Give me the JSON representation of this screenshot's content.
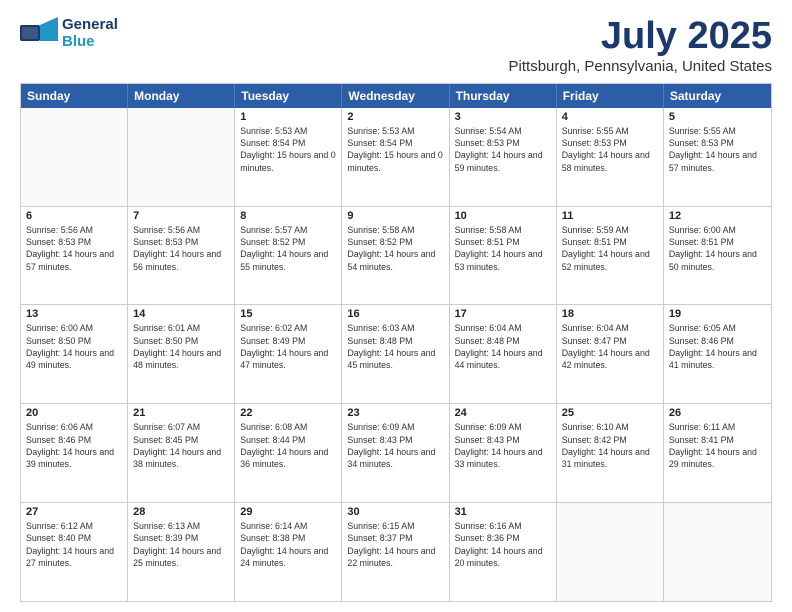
{
  "header": {
    "logo_general": "General",
    "logo_blue": "Blue",
    "main_title": "July 2025",
    "subtitle": "Pittsburgh, Pennsylvania, United States"
  },
  "calendar": {
    "days": [
      "Sunday",
      "Monday",
      "Tuesday",
      "Wednesday",
      "Thursday",
      "Friday",
      "Saturday"
    ],
    "rows": [
      [
        {
          "day": "",
          "empty": true
        },
        {
          "day": "",
          "empty": true
        },
        {
          "day": "1",
          "sunrise": "Sunrise: 5:53 AM",
          "sunset": "Sunset: 8:54 PM",
          "daylight": "Daylight: 15 hours and 0 minutes."
        },
        {
          "day": "2",
          "sunrise": "Sunrise: 5:53 AM",
          "sunset": "Sunset: 8:54 PM",
          "daylight": "Daylight: 15 hours and 0 minutes."
        },
        {
          "day": "3",
          "sunrise": "Sunrise: 5:54 AM",
          "sunset": "Sunset: 8:53 PM",
          "daylight": "Daylight: 14 hours and 59 minutes."
        },
        {
          "day": "4",
          "sunrise": "Sunrise: 5:55 AM",
          "sunset": "Sunset: 8:53 PM",
          "daylight": "Daylight: 14 hours and 58 minutes."
        },
        {
          "day": "5",
          "sunrise": "Sunrise: 5:55 AM",
          "sunset": "Sunset: 8:53 PM",
          "daylight": "Daylight: 14 hours and 57 minutes."
        }
      ],
      [
        {
          "day": "6",
          "sunrise": "Sunrise: 5:56 AM",
          "sunset": "Sunset: 8:53 PM",
          "daylight": "Daylight: 14 hours and 57 minutes."
        },
        {
          "day": "7",
          "sunrise": "Sunrise: 5:56 AM",
          "sunset": "Sunset: 8:53 PM",
          "daylight": "Daylight: 14 hours and 56 minutes."
        },
        {
          "day": "8",
          "sunrise": "Sunrise: 5:57 AM",
          "sunset": "Sunset: 8:52 PM",
          "daylight": "Daylight: 14 hours and 55 minutes."
        },
        {
          "day": "9",
          "sunrise": "Sunrise: 5:58 AM",
          "sunset": "Sunset: 8:52 PM",
          "daylight": "Daylight: 14 hours and 54 minutes."
        },
        {
          "day": "10",
          "sunrise": "Sunrise: 5:58 AM",
          "sunset": "Sunset: 8:51 PM",
          "daylight": "Daylight: 14 hours and 53 minutes."
        },
        {
          "day": "11",
          "sunrise": "Sunrise: 5:59 AM",
          "sunset": "Sunset: 8:51 PM",
          "daylight": "Daylight: 14 hours and 52 minutes."
        },
        {
          "day": "12",
          "sunrise": "Sunrise: 6:00 AM",
          "sunset": "Sunset: 8:51 PM",
          "daylight": "Daylight: 14 hours and 50 minutes."
        }
      ],
      [
        {
          "day": "13",
          "sunrise": "Sunrise: 6:00 AM",
          "sunset": "Sunset: 8:50 PM",
          "daylight": "Daylight: 14 hours and 49 minutes."
        },
        {
          "day": "14",
          "sunrise": "Sunrise: 6:01 AM",
          "sunset": "Sunset: 8:50 PM",
          "daylight": "Daylight: 14 hours and 48 minutes."
        },
        {
          "day": "15",
          "sunrise": "Sunrise: 6:02 AM",
          "sunset": "Sunset: 8:49 PM",
          "daylight": "Daylight: 14 hours and 47 minutes."
        },
        {
          "day": "16",
          "sunrise": "Sunrise: 6:03 AM",
          "sunset": "Sunset: 8:48 PM",
          "daylight": "Daylight: 14 hours and 45 minutes."
        },
        {
          "day": "17",
          "sunrise": "Sunrise: 6:04 AM",
          "sunset": "Sunset: 8:48 PM",
          "daylight": "Daylight: 14 hours and 44 minutes."
        },
        {
          "day": "18",
          "sunrise": "Sunrise: 6:04 AM",
          "sunset": "Sunset: 8:47 PM",
          "daylight": "Daylight: 14 hours and 42 minutes."
        },
        {
          "day": "19",
          "sunrise": "Sunrise: 6:05 AM",
          "sunset": "Sunset: 8:46 PM",
          "daylight": "Daylight: 14 hours and 41 minutes."
        }
      ],
      [
        {
          "day": "20",
          "sunrise": "Sunrise: 6:06 AM",
          "sunset": "Sunset: 8:46 PM",
          "daylight": "Daylight: 14 hours and 39 minutes."
        },
        {
          "day": "21",
          "sunrise": "Sunrise: 6:07 AM",
          "sunset": "Sunset: 8:45 PM",
          "daylight": "Daylight: 14 hours and 38 minutes."
        },
        {
          "day": "22",
          "sunrise": "Sunrise: 6:08 AM",
          "sunset": "Sunset: 8:44 PM",
          "daylight": "Daylight: 14 hours and 36 minutes."
        },
        {
          "day": "23",
          "sunrise": "Sunrise: 6:09 AM",
          "sunset": "Sunset: 8:43 PM",
          "daylight": "Daylight: 14 hours and 34 minutes."
        },
        {
          "day": "24",
          "sunrise": "Sunrise: 6:09 AM",
          "sunset": "Sunset: 8:43 PM",
          "daylight": "Daylight: 14 hours and 33 minutes."
        },
        {
          "day": "25",
          "sunrise": "Sunrise: 6:10 AM",
          "sunset": "Sunset: 8:42 PM",
          "daylight": "Daylight: 14 hours and 31 minutes."
        },
        {
          "day": "26",
          "sunrise": "Sunrise: 6:11 AM",
          "sunset": "Sunset: 8:41 PM",
          "daylight": "Daylight: 14 hours and 29 minutes."
        }
      ],
      [
        {
          "day": "27",
          "sunrise": "Sunrise: 6:12 AM",
          "sunset": "Sunset: 8:40 PM",
          "daylight": "Daylight: 14 hours and 27 minutes."
        },
        {
          "day": "28",
          "sunrise": "Sunrise: 6:13 AM",
          "sunset": "Sunset: 8:39 PM",
          "daylight": "Daylight: 14 hours and 25 minutes."
        },
        {
          "day": "29",
          "sunrise": "Sunrise: 6:14 AM",
          "sunset": "Sunset: 8:38 PM",
          "daylight": "Daylight: 14 hours and 24 minutes."
        },
        {
          "day": "30",
          "sunrise": "Sunrise: 6:15 AM",
          "sunset": "Sunset: 8:37 PM",
          "daylight": "Daylight: 14 hours and 22 minutes."
        },
        {
          "day": "31",
          "sunrise": "Sunrise: 6:16 AM",
          "sunset": "Sunset: 8:36 PM",
          "daylight": "Daylight: 14 hours and 20 minutes."
        },
        {
          "day": "",
          "empty": true
        },
        {
          "day": "",
          "empty": true
        }
      ]
    ]
  }
}
